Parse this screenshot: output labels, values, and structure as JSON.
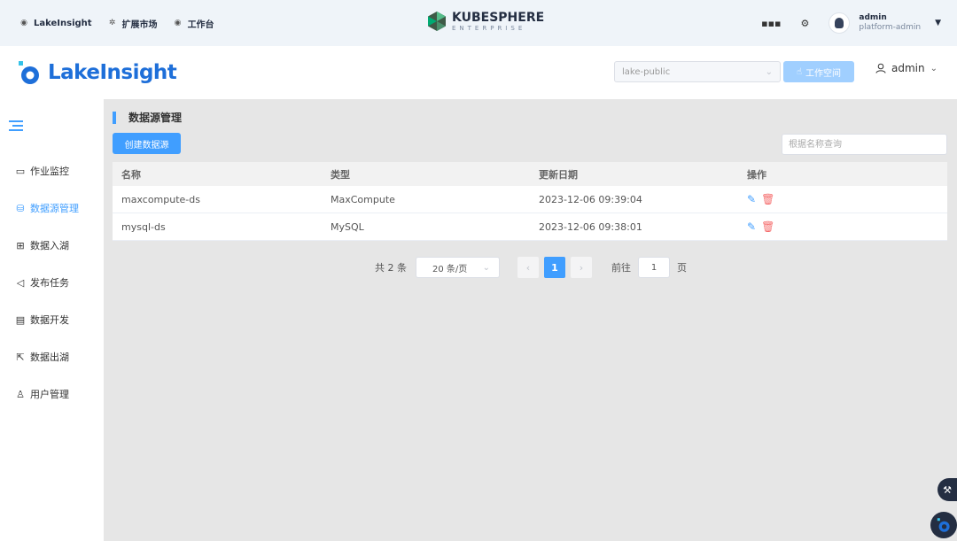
{
  "ks_bar": {
    "nav": [
      {
        "label": "LakeInsight",
        "icon": "app-icon"
      },
      {
        "label": "扩展市场",
        "icon": "extension-icon"
      },
      {
        "label": "工作台",
        "icon": "workbench-icon"
      }
    ],
    "logo_title": "KUBESPHERE",
    "logo_sub": "ENTERPRISE",
    "user_name": "admin",
    "user_role": "platform-admin"
  },
  "app_header": {
    "brand": "LakeInsight",
    "workspace_value": "lake-public",
    "workspace_button": "工作空间",
    "user": "admin"
  },
  "sidebar": {
    "items": [
      {
        "label": "作业监控",
        "icon": "monitor-icon",
        "active": false
      },
      {
        "label": "数据源管理",
        "icon": "database-icon",
        "active": true
      },
      {
        "label": "数据入湖",
        "icon": "import-icon",
        "active": false
      },
      {
        "label": "发布任务",
        "icon": "send-icon",
        "active": false
      },
      {
        "label": "数据开发",
        "icon": "document-icon",
        "active": false
      },
      {
        "label": "数据出湖",
        "icon": "export-icon",
        "active": false
      },
      {
        "label": "用户管理",
        "icon": "user-icon",
        "active": false
      }
    ]
  },
  "main": {
    "title": "数据源管理",
    "create_button": "创建数据源",
    "search_placeholder": "根据名称查询",
    "table": {
      "headers": [
        "名称",
        "类型",
        "更新日期",
        "操作"
      ],
      "rows": [
        {
          "name": "maxcompute-ds",
          "type": "MaxCompute",
          "updated": "2023-12-06 09:39:04"
        },
        {
          "name": "mysql-ds",
          "type": "MySQL",
          "updated": "2023-12-06 09:38:01"
        }
      ]
    },
    "pager": {
      "total": "共 2 条",
      "page_size": "20 条/页",
      "current_page": "1",
      "goto_label": "前往",
      "goto_value": "1",
      "page_unit": "页"
    }
  },
  "colors": {
    "primary": "#409eff",
    "danger": "#f56c6c",
    "brand": "#1e6fd9"
  }
}
